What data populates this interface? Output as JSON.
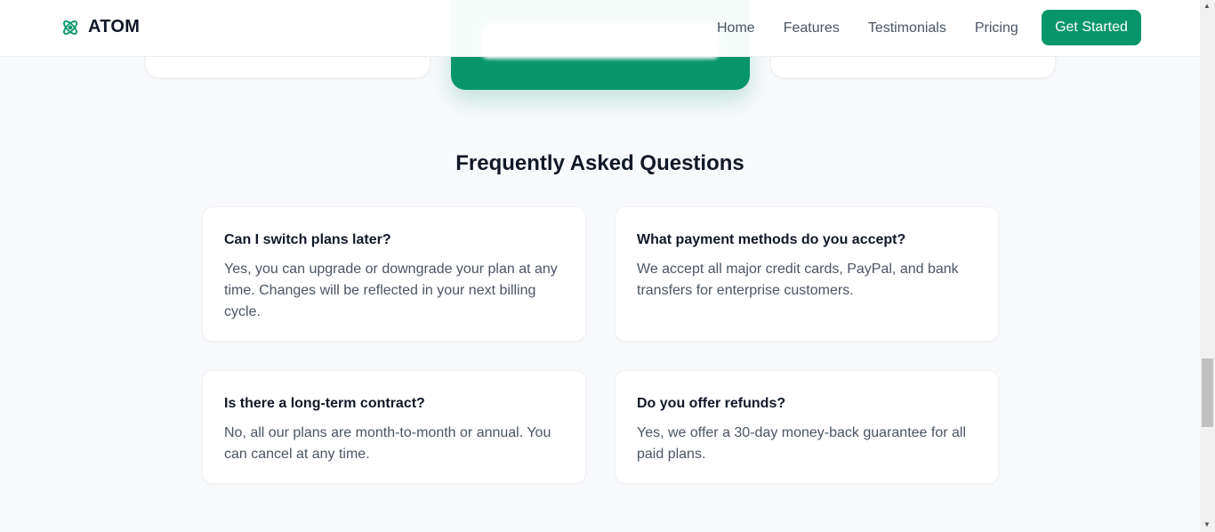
{
  "header": {
    "brand": "ATOM",
    "nav": [
      "Home",
      "Features",
      "Testimonials",
      "Pricing"
    ],
    "cta_label": "Get Started"
  },
  "faq": {
    "title": "Frequently Asked Questions",
    "items": [
      {
        "question": "Can I switch plans later?",
        "answer": "Yes, you can upgrade or downgrade your plan at any time. Changes will be reflected in your next billing cycle."
      },
      {
        "question": "What payment methods do you accept?",
        "answer": "We accept all major credit cards, PayPal, and bank transfers for enterprise customers."
      },
      {
        "question": "Is there a long-term contract?",
        "answer": "No, all our plans are month-to-month or annual. You can cancel at any time."
      },
      {
        "question": "Do you offer refunds?",
        "answer": "Yes, we offer a 30-day money-back guarantee for all paid plans."
      }
    ]
  },
  "colors": {
    "accent": "#079669",
    "text_dark": "#111827",
    "text_muted": "#4b5563",
    "background": "#f8f9fb"
  },
  "icons": {
    "logo": "atom-icon"
  }
}
